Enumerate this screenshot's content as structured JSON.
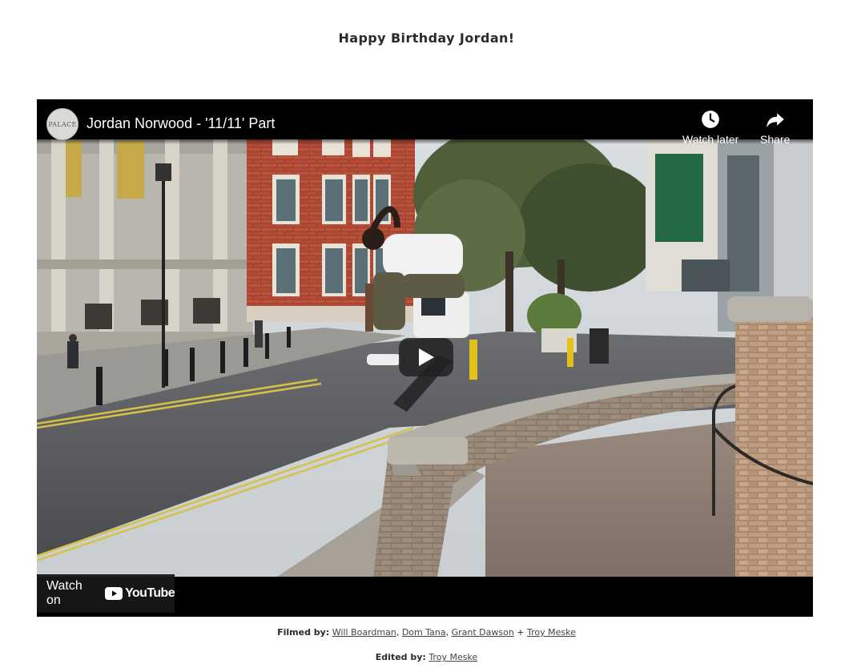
{
  "post": {
    "title": "Happy Birthday Jordan!"
  },
  "video": {
    "title": "Jordan Norwood - '11/11' Part",
    "channel_avatar_text": "PALACE",
    "watch_later_label": "Watch later",
    "share_label": "Share",
    "watch_on_label": "Watch on",
    "youtube_label": "YouTube"
  },
  "credits": {
    "filmed_label": "Filmed by:",
    "filmers": [
      "Will Boardman",
      "Dom Tana",
      "Grant Dawson",
      "Troy Meske"
    ],
    "comma": ",",
    "plus": "+",
    "edited_label": "Edited by:",
    "editor": "Troy Meske"
  },
  "colors": {
    "youtube_red": "#ff0000",
    "player_bg": "#000000",
    "brick": "#b8503a"
  },
  "icons": {
    "watch_later": "clock-icon",
    "share": "share-arrow-icon",
    "play": "play-icon",
    "youtube": "youtube-logo-icon"
  }
}
